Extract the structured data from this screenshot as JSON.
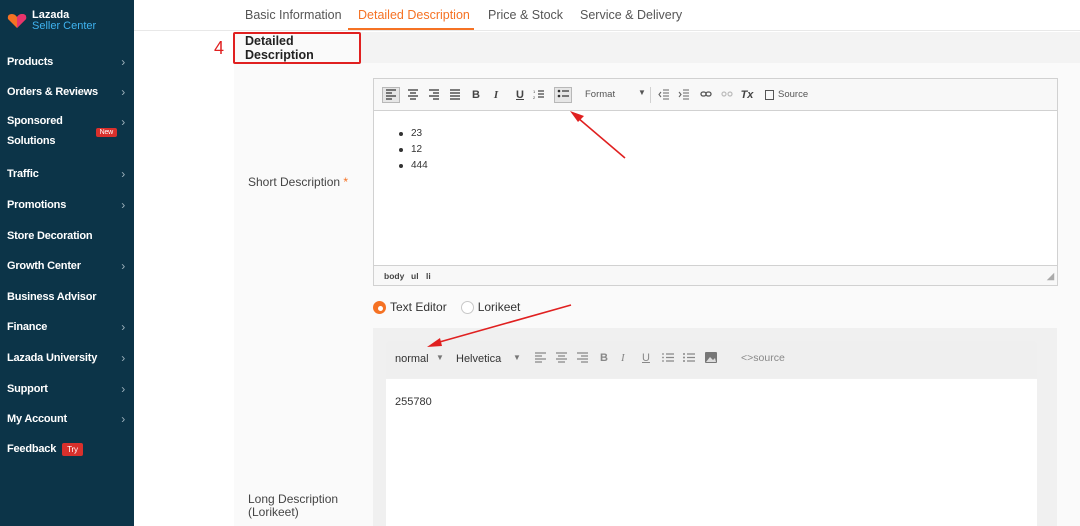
{
  "sidebar": {
    "logo_line1": "Lazada",
    "logo_line2": "Seller Center",
    "items": [
      {
        "label": "Products",
        "chevron": true
      },
      {
        "label": "Orders & Reviews",
        "chevron": true
      },
      {
        "label": "Sponsored",
        "label2": "Solutions",
        "chevron": true,
        "badge": "New"
      },
      {
        "label": "Traffic",
        "chevron": true
      },
      {
        "label": "Promotions",
        "chevron": true
      },
      {
        "label": "Store Decoration",
        "chevron": false
      },
      {
        "label": "Growth Center",
        "chevron": true
      },
      {
        "label": "Business Advisor",
        "chevron": false
      },
      {
        "label": "Finance",
        "chevron": true
      },
      {
        "label": "Lazada University",
        "chevron": true
      },
      {
        "label": "Support",
        "chevron": true
      },
      {
        "label": "My Account",
        "chevron": true
      },
      {
        "label": "Feedback",
        "chevron": false,
        "badge": "Try"
      }
    ]
  },
  "tabs": [
    {
      "label": "Basic Information",
      "active": false
    },
    {
      "label": "Detailed Description",
      "active": true
    },
    {
      "label": "Price & Stock",
      "active": false
    },
    {
      "label": "Service & Delivery",
      "active": false
    }
  ],
  "section": {
    "number": "4",
    "title": "Detailed Description"
  },
  "short_description": {
    "label": "Short Description",
    "required_mark": "*",
    "toolbar": {
      "bold": "B",
      "italic": "I",
      "underline": "U",
      "format_label": "Format",
      "clear_format": "Tx",
      "source_label": "Source"
    },
    "list_items": [
      "23",
      "12",
      "444"
    ],
    "path": [
      "body",
      "ul",
      "li"
    ]
  },
  "editor_choice": {
    "options": [
      {
        "label": "Text Editor",
        "selected": true
      },
      {
        "label": "Lorikeet",
        "selected": false
      }
    ]
  },
  "long_description": {
    "label_line1": "Long Description",
    "label_line2": "(Lorikeet)",
    "toolbar": {
      "size": "normal",
      "font": "Helvetica",
      "bold": "B",
      "italic": "I",
      "underline": "U",
      "source_label": "<>source"
    },
    "content": "255780"
  },
  "colors": {
    "sidebar_bg": "#0c3448",
    "accent": "#f57224",
    "annotation_red": "#e02020"
  }
}
